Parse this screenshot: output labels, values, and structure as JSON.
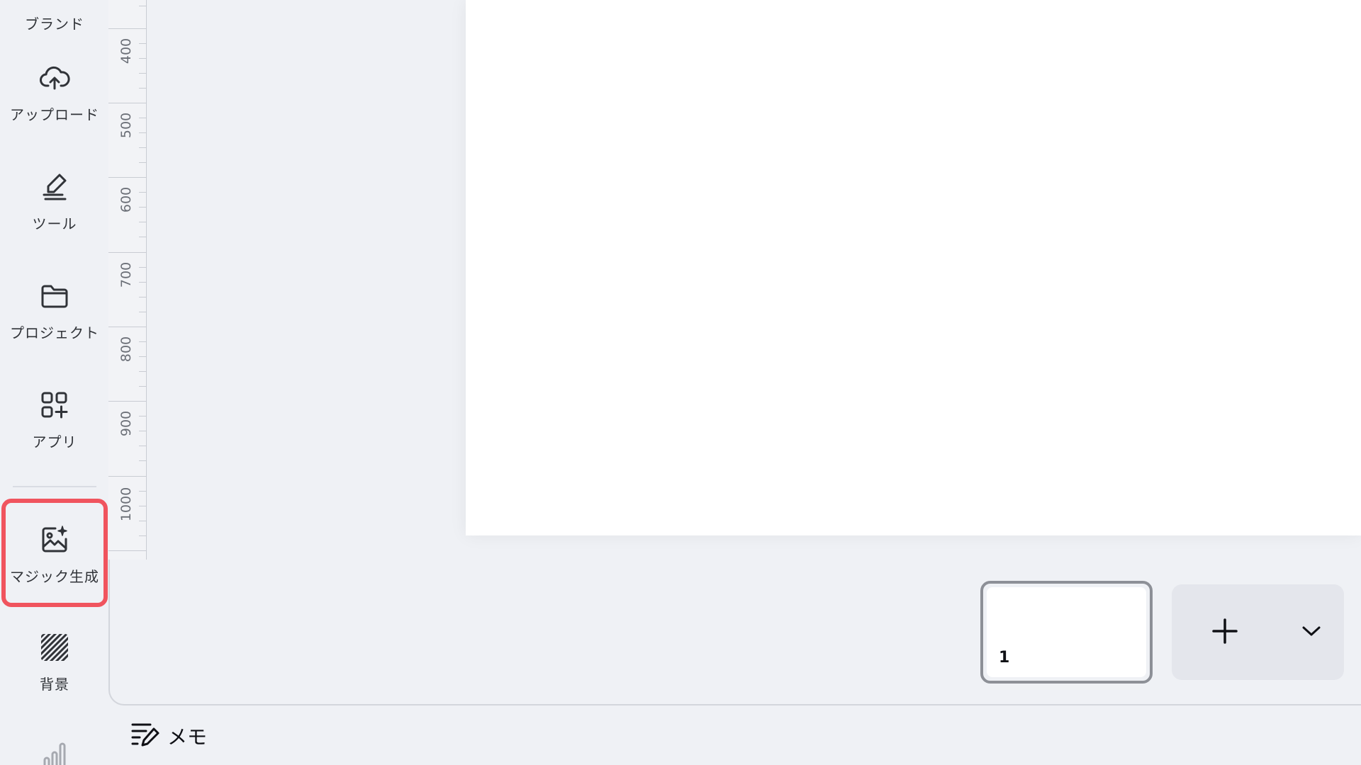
{
  "sidebar": {
    "items": [
      {
        "label": "ブランド",
        "icon": "brand-icon"
      },
      {
        "label": "アップロード",
        "icon": "cloud-upload-icon"
      },
      {
        "label": "ツール",
        "icon": "pen-tool-icon"
      },
      {
        "label": "プロジェクト",
        "icon": "folder-icon"
      },
      {
        "label": "アプリ",
        "icon": "apps-grid-plus-icon"
      },
      {
        "label": "マジック生成",
        "icon": "magic-image-icon"
      },
      {
        "label": "背景",
        "icon": "background-hatch-icon"
      },
      {
        "label": "",
        "icon": "chart-icon"
      }
    ],
    "highlight_color": "#f0545e"
  },
  "ruler": {
    "labels": [
      "400",
      "500",
      "600",
      "700",
      "800",
      "900",
      "1000"
    ]
  },
  "pages": {
    "current_page_number": "1"
  },
  "add_page": {
    "add_icon": "plus-icon",
    "dropdown_icon": "chevron-down-icon"
  },
  "notes": {
    "label": "メモ",
    "icon": "notes-pencil-icon"
  }
}
